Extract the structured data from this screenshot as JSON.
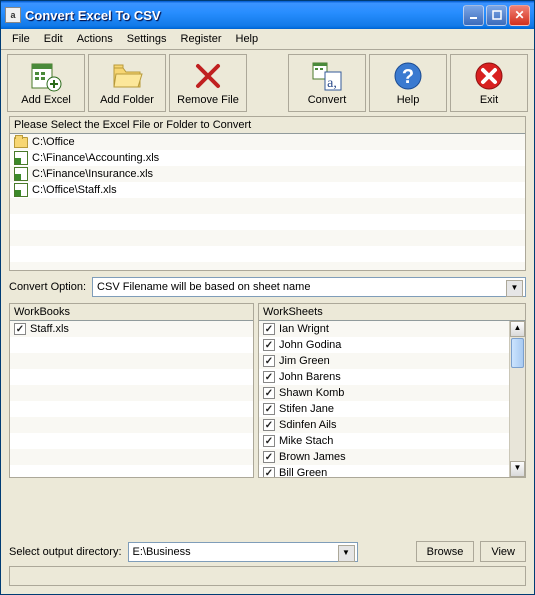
{
  "window": {
    "title": "Convert Excel To CSV"
  },
  "menu": {
    "items": [
      "File",
      "Edit",
      "Actions",
      "Settings",
      "Register",
      "Help"
    ]
  },
  "toolbar": {
    "add_excel": "Add Excel",
    "add_folder": "Add Folder",
    "remove_file": "Remove File",
    "convert": "Convert",
    "help": "Help",
    "exit": "Exit"
  },
  "file_panel": {
    "header": "Please Select the Excel File or Folder to Convert",
    "items": [
      {
        "type": "folder",
        "path": "C:\\Office"
      },
      {
        "type": "xls",
        "path": "C:\\Finance\\Accounting.xls"
      },
      {
        "type": "xls",
        "path": "C:\\Finance\\Insurance.xls"
      },
      {
        "type": "xls",
        "path": "C:\\Office\\Staff.xls"
      }
    ]
  },
  "convert_option": {
    "label": "Convert Option:",
    "value": "CSV Filename will be based on sheet name"
  },
  "workbooks": {
    "header": "WorkBooks",
    "items": [
      {
        "name": "Staff.xls",
        "checked": true
      }
    ]
  },
  "worksheets": {
    "header": "WorkSheets",
    "items": [
      {
        "name": "Ian Wrignt",
        "checked": true
      },
      {
        "name": "John Godina",
        "checked": true
      },
      {
        "name": "Jim Green",
        "checked": true
      },
      {
        "name": "John Barens",
        "checked": true
      },
      {
        "name": "Shawn Komb",
        "checked": true
      },
      {
        "name": "Stifen Jane",
        "checked": true
      },
      {
        "name": "Sdinfen Ails",
        "checked": true
      },
      {
        "name": "Mike Stach",
        "checked": true
      },
      {
        "name": "Brown James",
        "checked": true
      },
      {
        "name": "Bill Green",
        "checked": true
      }
    ]
  },
  "output": {
    "label": "Select  output directory:",
    "value": "E:\\Business",
    "browse": "Browse",
    "view": "View"
  }
}
